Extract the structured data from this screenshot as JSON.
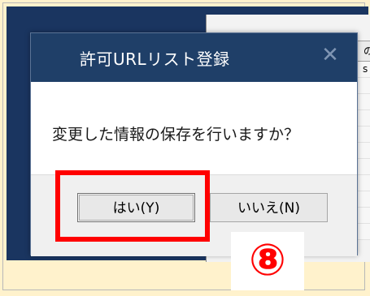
{
  "background": {
    "column_header": "の",
    "row_text": "s"
  },
  "dialog": {
    "title": "許可URLリスト登録",
    "close_glyph": "✕",
    "message": "変更した情報の保存を行いますか？",
    "yes_label": "はい(Y)",
    "no_label": "いいえ(N)"
  },
  "annotation": {
    "step": "⑧",
    "highlight_color": "#ff0000"
  },
  "colors": {
    "page_bg": "#fff2cc",
    "titlebar": "#1f3f68",
    "bg_window": "#1a3560"
  }
}
